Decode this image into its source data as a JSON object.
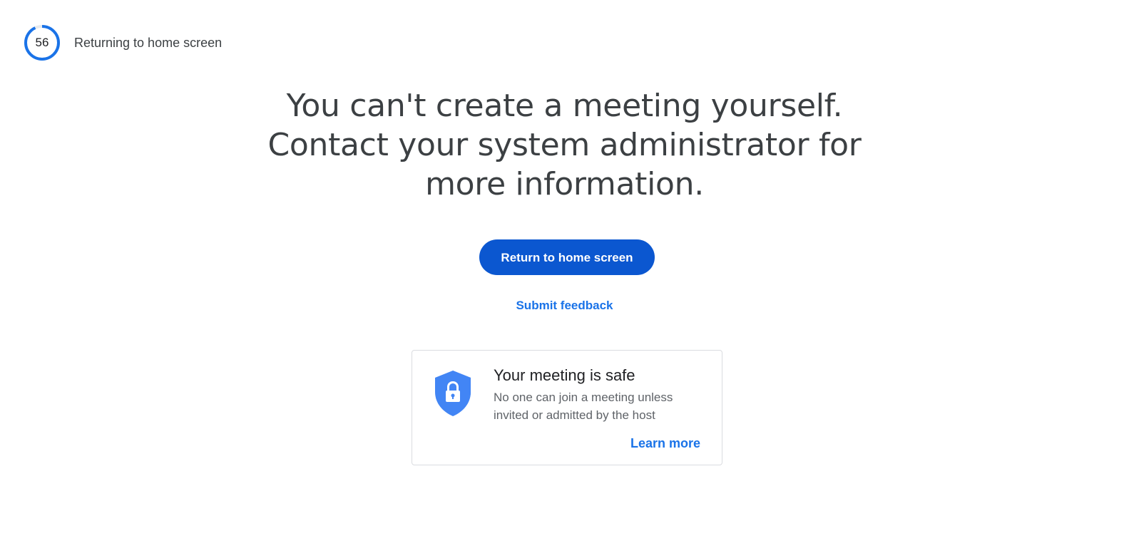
{
  "countdown": {
    "seconds": "56",
    "label": "Returning to home screen",
    "progress_fraction": 0.93,
    "accent_color": "#1a73e8"
  },
  "headline": {
    "line1": "You can't create a meeting yourself.",
    "line2": "Contact your system administrator for",
    "line3": "more information."
  },
  "actions": {
    "return_label": "Return to home screen",
    "feedback_label": "Submit feedback",
    "primary_color": "#0b57d0",
    "link_color": "#1a73e8"
  },
  "safe_card": {
    "icon": "shield-lock-icon",
    "title": "Your meeting is safe",
    "description": "No one can join a meeting unless invited or admitted by the host",
    "learn_more_label": "Learn more",
    "icon_color": "#4285f4"
  }
}
